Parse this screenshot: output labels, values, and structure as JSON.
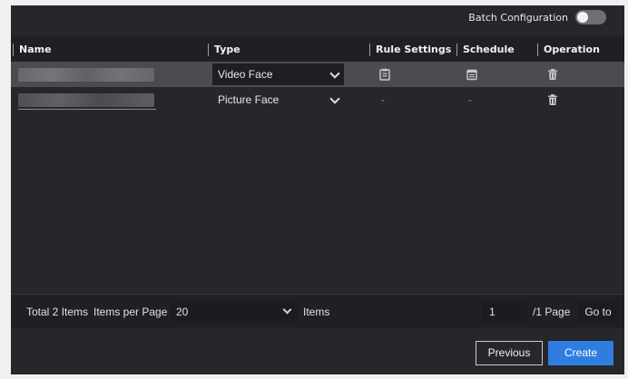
{
  "toolbar": {
    "batch_label": "Batch Configuration",
    "toggle_on": false
  },
  "table": {
    "columns": [
      "Name",
      "Type",
      "Rule Settings",
      "Schedule",
      "Operation"
    ],
    "rows": [
      {
        "type": "Video Face",
        "rule_icon": "clipboard-icon",
        "schedule_icon": "calendar-icon",
        "operation_icon": "trash-icon"
      },
      {
        "type": "Picture Face",
        "rule": "-",
        "schedule": "-",
        "operation_icon": "trash-icon"
      }
    ]
  },
  "pagination": {
    "total": "Total 2 Items",
    "items_per_page_label": "Items per Page",
    "items_per_page": "20",
    "items_label": "Items",
    "page": "1",
    "page_total": "/1 Page",
    "goto": "Go to"
  },
  "buttons": {
    "previous": "Previous",
    "create": "Create"
  },
  "colors": {
    "accent": "#2f7de1",
    "background": "#25272b",
    "header": "#1e2023",
    "selected_row": "#4a4c50"
  }
}
